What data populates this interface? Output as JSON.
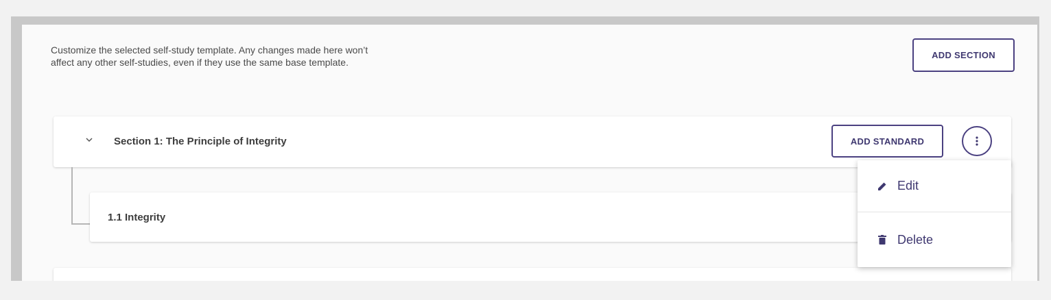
{
  "description": {
    "line1": "Customize the selected self-study template. Any changes made here won’t",
    "line2": "affect any other self-studies, even if they use the same base template."
  },
  "toolbar": {
    "add_section_label": "ADD SECTION"
  },
  "section": {
    "title": "Section 1: The Principle of Integrity",
    "add_standard_label": "ADD STANDARD",
    "chevron_icon": "chevron-down-icon",
    "more_icon": "more-vertical-icon"
  },
  "standards": [
    {
      "title": "1.1 Integrity"
    }
  ],
  "menu": {
    "items": [
      {
        "label": "Edit",
        "icon": "pencil-icon"
      },
      {
        "label": "Delete",
        "icon": "trash-icon"
      }
    ]
  },
  "colors": {
    "accent": "#3f3870",
    "border": "#4a4080",
    "text": "#3d3d3d",
    "muted_text": "#4a4a4a",
    "background": "#fafafa",
    "frame": "#c8c8c8"
  }
}
